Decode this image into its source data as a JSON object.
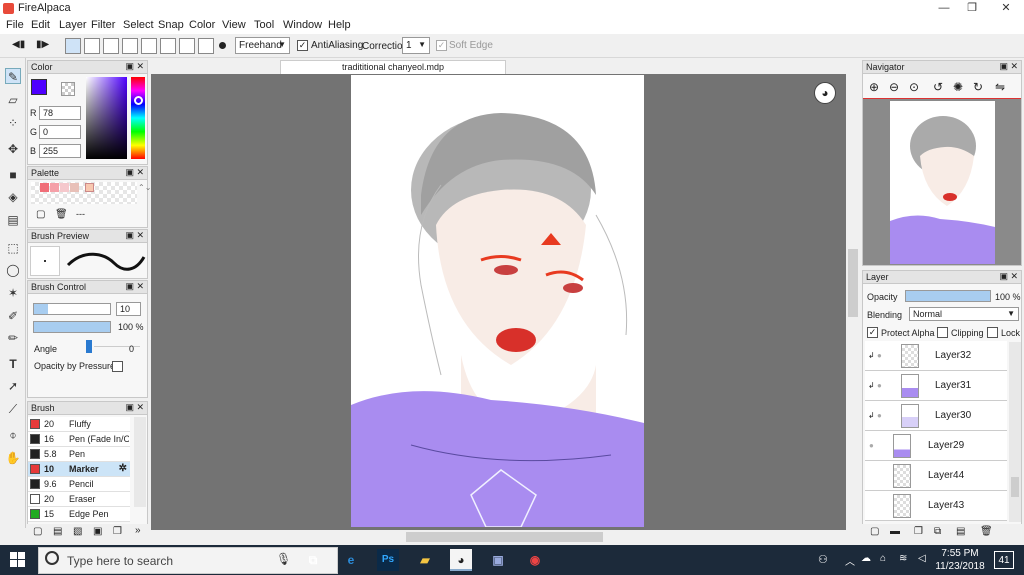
{
  "app": {
    "title": "FireAlpaca"
  },
  "menu": [
    "File",
    "Edit",
    "Layer",
    "Filter",
    "Select",
    "Snap",
    "Color",
    "View",
    "Tool",
    "Window",
    "Help"
  ],
  "toolbar": {
    "mode": "Freehand",
    "antialiasing_label": "AntiAliasing",
    "correction_label": "Correction",
    "correction_value": "1",
    "soft_edge_label": "Soft Edge"
  },
  "document": {
    "tab": "tradititional chanyeol.mdp"
  },
  "color": {
    "title": "Color",
    "r_label": "R",
    "r": "78",
    "g_label": "G",
    "g": "0",
    "b_label": "B",
    "b": "255",
    "primary": "#4e00ff"
  },
  "palette": {
    "title": "Palette",
    "swatches": [
      "#f06e78",
      "#f5a0a8",
      "#f5c8cc",
      "#e8c0b8",
      "#f8c8b0"
    ],
    "minus": "---"
  },
  "brush_preview": {
    "title": "Brush Preview"
  },
  "brush_control": {
    "title": "Brush Control",
    "size": "10",
    "opacity": "100 %",
    "angle_label": "Angle",
    "angle": "0",
    "pressure_label": "Opacity by Pressure"
  },
  "brush": {
    "title": "Brush",
    "items": [
      {
        "size": "20",
        "name": "Fluffy",
        "color": "#e63a3a"
      },
      {
        "size": "16",
        "name": "Pen (Fade In/Ou",
        "color": "#222222"
      },
      {
        "size": "5.8",
        "name": "Pen",
        "color": "#222222"
      },
      {
        "size": "10",
        "name": "Marker",
        "color": "#e63a3a"
      },
      {
        "size": "9.6",
        "name": "Pencil",
        "color": "#222222"
      },
      {
        "size": "20",
        "name": "Eraser",
        "color": "#ffffff"
      },
      {
        "size": "15",
        "name": "Edge Pen",
        "color": "#22aa22"
      }
    ]
  },
  "navigator": {
    "title": "Navigator"
  },
  "layer": {
    "title": "Layer",
    "opacity_label": "Opacity",
    "opacity": "100 %",
    "blending_label": "Blending",
    "blending": "Normal",
    "protect_alpha": "Protect Alpha",
    "clipping": "Clipping",
    "lock": "Lock",
    "items": [
      "Layer32",
      "Layer31",
      "Layer30",
      "Layer29",
      "Layer44",
      "Layer43"
    ]
  },
  "taskbar": {
    "search": "Type here to search",
    "time": "7:55 PM",
    "date": "11/23/2018",
    "notify": "41"
  }
}
